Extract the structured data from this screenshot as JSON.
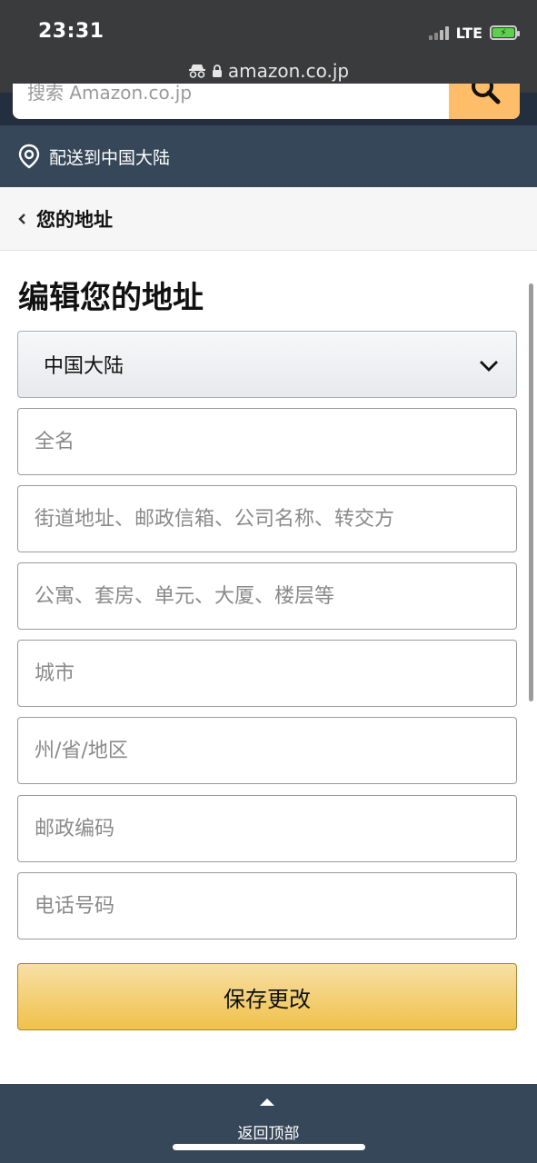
{
  "status_bar": {
    "time": "23:31",
    "network": "LTE"
  },
  "browser": {
    "url": "amazon.co.jp"
  },
  "search": {
    "placeholder": "搜索 Amazon.co.jp"
  },
  "deliver": {
    "label": "配送到中国大陆"
  },
  "breadcrumb": {
    "label": "您的地址"
  },
  "form": {
    "title": "编辑您的地址",
    "country": "中国大陆",
    "fields": {
      "full_name": "全名",
      "street": "街道地址、邮政信箱、公司名称、转交方",
      "apartment": "公寓、套房、单元、大厦、楼层等",
      "city": "城市",
      "state": "州/省/地区",
      "postal": "邮政编码",
      "phone": "电话号码"
    },
    "save_label": "保存更改"
  },
  "footer": {
    "back_to_top": "返回顶部"
  },
  "colors": {
    "nav_dark": "#232f3e",
    "nav_sub": "#37475a",
    "search_button": "#febd69",
    "save_button": "#f0c14b"
  }
}
